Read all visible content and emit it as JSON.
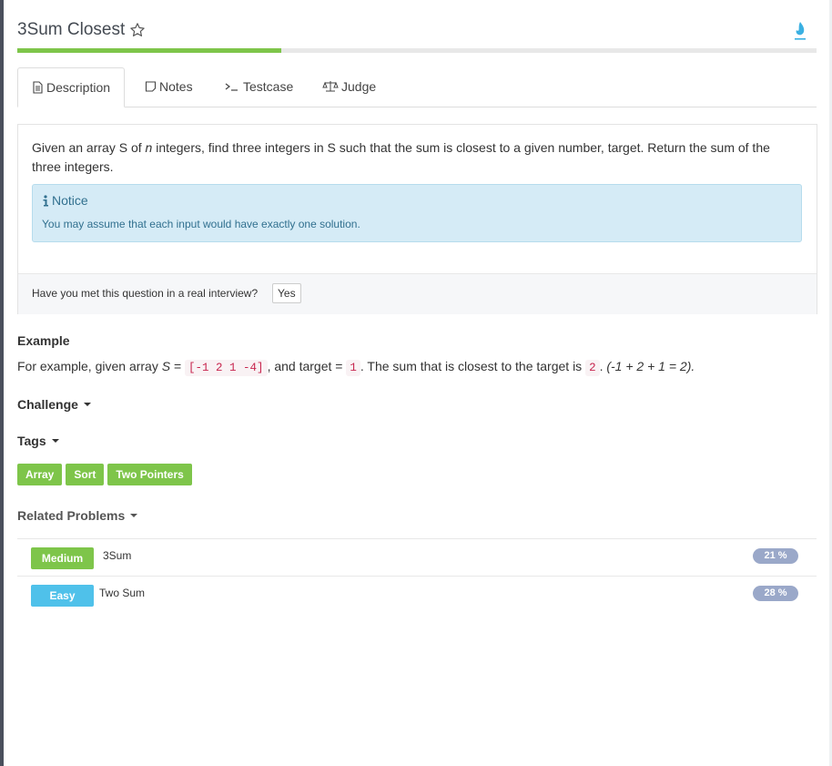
{
  "problem": {
    "title": "3Sum Closest",
    "progress_percent": 33
  },
  "tabs": [
    {
      "label": "Description",
      "icon": "document-icon",
      "active": true
    },
    {
      "label": "Notes",
      "icon": "note-icon",
      "active": false
    },
    {
      "label": "Testcase",
      "icon": "terminal-icon",
      "active": false
    },
    {
      "label": "Judge",
      "icon": "scale-icon",
      "active": false
    }
  ],
  "description": {
    "part1": "Given an array S of ",
    "n": "n",
    "part2": " integers, find three integers in S such that the sum is closest to a given number, target. Return the sum of the three integers."
  },
  "notice": {
    "title": "Notice",
    "text": "You may assume that each input would have exactly one solution."
  },
  "interview": {
    "question": "Have you met this question in a real interview?",
    "yes_label": "Yes"
  },
  "example": {
    "heading": "Example",
    "t1": "For example, given array ",
    "s": "S",
    "t2": " = ",
    "array": "[-1 2 1 -4]",
    "t3": ", and target = ",
    "target": "1",
    "t4": ". The sum that is closest to the target is ",
    "answer": "2",
    "t5": ". ",
    "explain": "(-1 + 2 + 1 = 2)."
  },
  "challenge": {
    "label": "Challenge"
  },
  "tags_section": {
    "label": "Tags",
    "tags": [
      "Array",
      "Sort",
      "Two Pointers"
    ]
  },
  "related": {
    "label": "Related Problems",
    "items": [
      {
        "difficulty": "Medium",
        "name": "3Sum",
        "percent": "21 %",
        "color": "#7ec54a"
      },
      {
        "difficulty": "Easy",
        "name": "Two Sum",
        "percent": "28 %",
        "color": "#4fc1ea"
      }
    ]
  },
  "colors": {
    "accent_green": "#7ec54a",
    "easy_blue": "#4fc1ea",
    "badge_gray": "#9aa8c9",
    "fire": "#3ab0e2"
  }
}
